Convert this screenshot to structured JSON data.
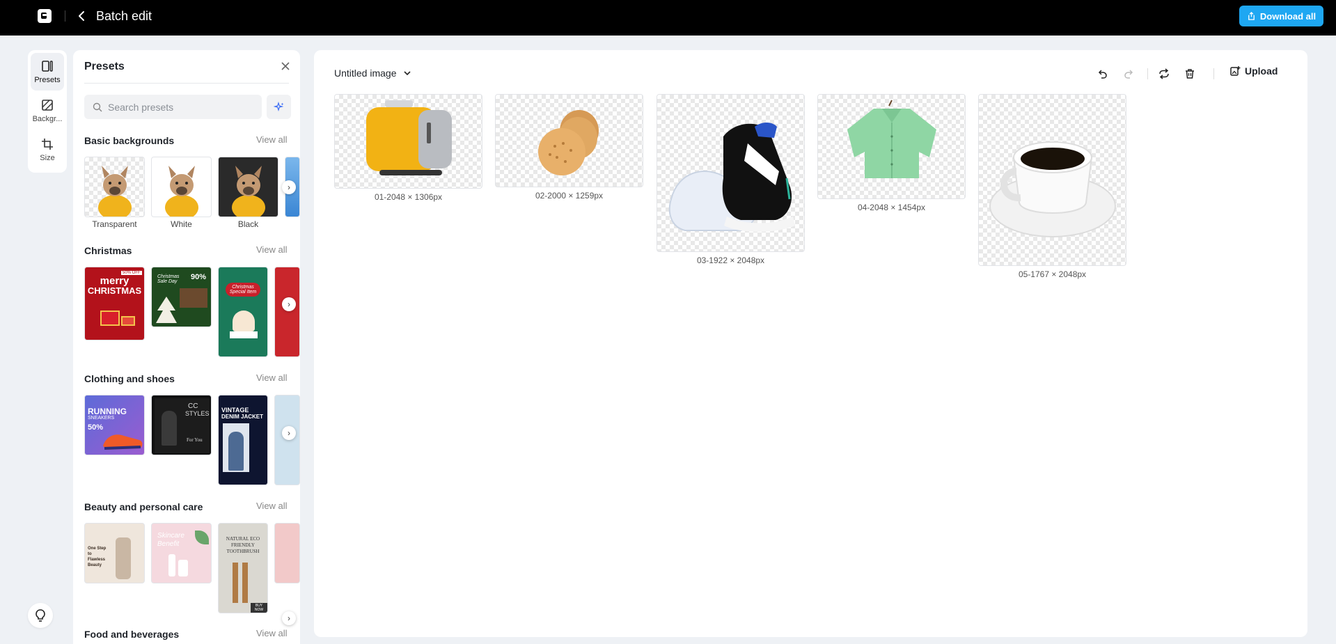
{
  "header": {
    "title": "Batch edit",
    "download_label": "Download all"
  },
  "rail": {
    "items": [
      {
        "label": "Presets",
        "icon": "presets-icon"
      },
      {
        "label": "Backgr...",
        "icon": "background-icon"
      },
      {
        "label": "Size",
        "icon": "crop-icon"
      }
    ]
  },
  "presets": {
    "title": "Presets",
    "search_placeholder": "Search presets",
    "view_all": "View all",
    "sections": [
      {
        "title": "Basic backgrounds",
        "labels": [
          "Transparent",
          "White",
          "Black"
        ]
      },
      {
        "title": "Christmas"
      },
      {
        "title": "Clothing and shoes"
      },
      {
        "title": "Beauty and personal care"
      },
      {
        "title": "Food and beverages"
      }
    ],
    "thumb_text": {
      "xmas1_line1": "merry",
      "xmas1_line2": "CHRISTMAS",
      "xmas1_badge": "50% OFF",
      "xmas2_text": "90%",
      "xmas2_script": "Christmas Sale Day",
      "xmas3_script": "Christmas Special Item",
      "cloth1_line1": "RUNNING",
      "cloth1_line2": "SNEAKERS",
      "cloth1_pct": "50%",
      "cloth2_line1": "CC",
      "cloth2_line2": "STYLES",
      "cloth2_line3": "For You",
      "cloth3_line1": "VINTAGE",
      "cloth3_line2": "DENIM JACKET",
      "beauty1_line1": "One Step",
      "beauty1_line2": "to",
      "beauty1_line3": "Flawless",
      "beauty1_line4": "Beauty",
      "beauty2_line1": "Skincare",
      "beauty2_line2": "Benefit",
      "beauty3_line1": "NATURAL ECO",
      "beauty3_line2": "FRIENDLY",
      "beauty3_line3": "TOOTHBRUSH",
      "beauty3_btn": "BUY NOW"
    }
  },
  "canvas": {
    "image_name": "Untitled image",
    "upload_label": "Upload",
    "images": [
      {
        "label": "01-2048 × 1306px",
        "subject": "toaster"
      },
      {
        "label": "02-2000 × 1259px",
        "subject": "crackers"
      },
      {
        "label": "03-1922 × 2048px",
        "subject": "sneaker"
      },
      {
        "label": "04-2048 × 1454px",
        "subject": "shirt"
      },
      {
        "label": "05-1767 × 2048px",
        "subject": "coffee-cup"
      }
    ]
  },
  "colors": {
    "accent": "#1ea7f2",
    "topbar": "#000000"
  }
}
